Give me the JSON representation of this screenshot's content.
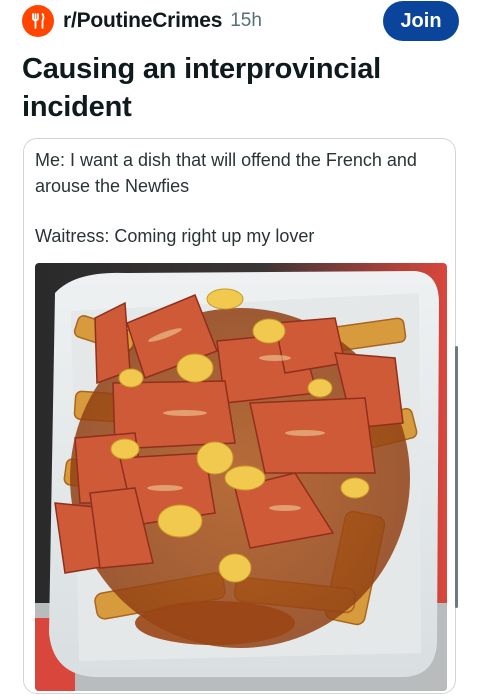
{
  "header": {
    "subreddit": "r/PoutineCrimes",
    "time": "15h",
    "join_label": "Join",
    "avatar_icon": "fork-knife-icon",
    "accent": "#ff4500",
    "join_color": "#0a449b"
  },
  "post": {
    "title": "Causing an interprovincial incident",
    "body_line_1": "Me: I want a dish that will offend the French and arouse the Newfies",
    "body_line_2": "Waitress: Coming right up my lover"
  },
  "image": {
    "subject": "poutine-with-fried-bologna-photo"
  }
}
